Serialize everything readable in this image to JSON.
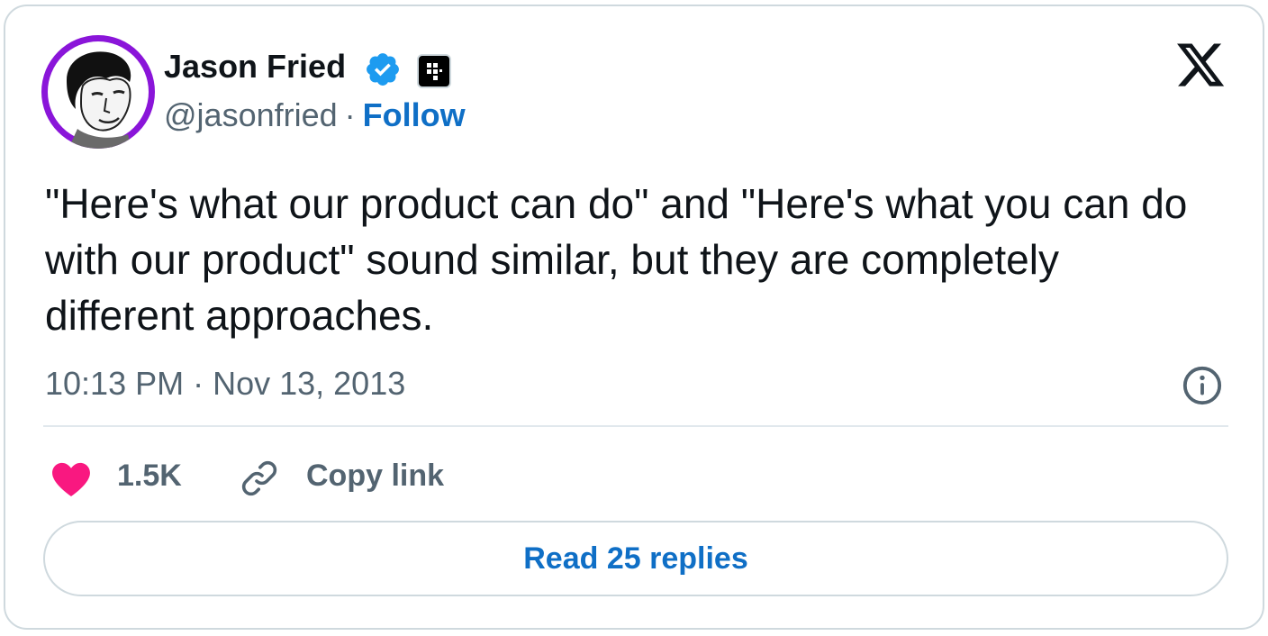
{
  "author": {
    "name": "Jason Fried",
    "handle": "@jasonfried",
    "separator": "·",
    "follow_label": "Follow",
    "avatar_bg": "#8a15d9",
    "verified_color": "#1d9bf0"
  },
  "tweet": {
    "text": "\"Here's what our product can do\" and \"Here's what you can do with our product\" sound similar, but they are completely different approaches.",
    "timestamp": "10:13 PM · Nov 13, 2013"
  },
  "actions": {
    "like_count": "1.5K",
    "copy_link_label": "Copy link",
    "read_replies_label": "Read 25 replies",
    "like_color": "#f91880",
    "link_color": "#0f6fc6"
  },
  "icons": [
    "x-logo-icon",
    "verified-badge-icon",
    "affiliate-badge-icon",
    "info-icon",
    "heart-icon",
    "link-icon"
  ]
}
